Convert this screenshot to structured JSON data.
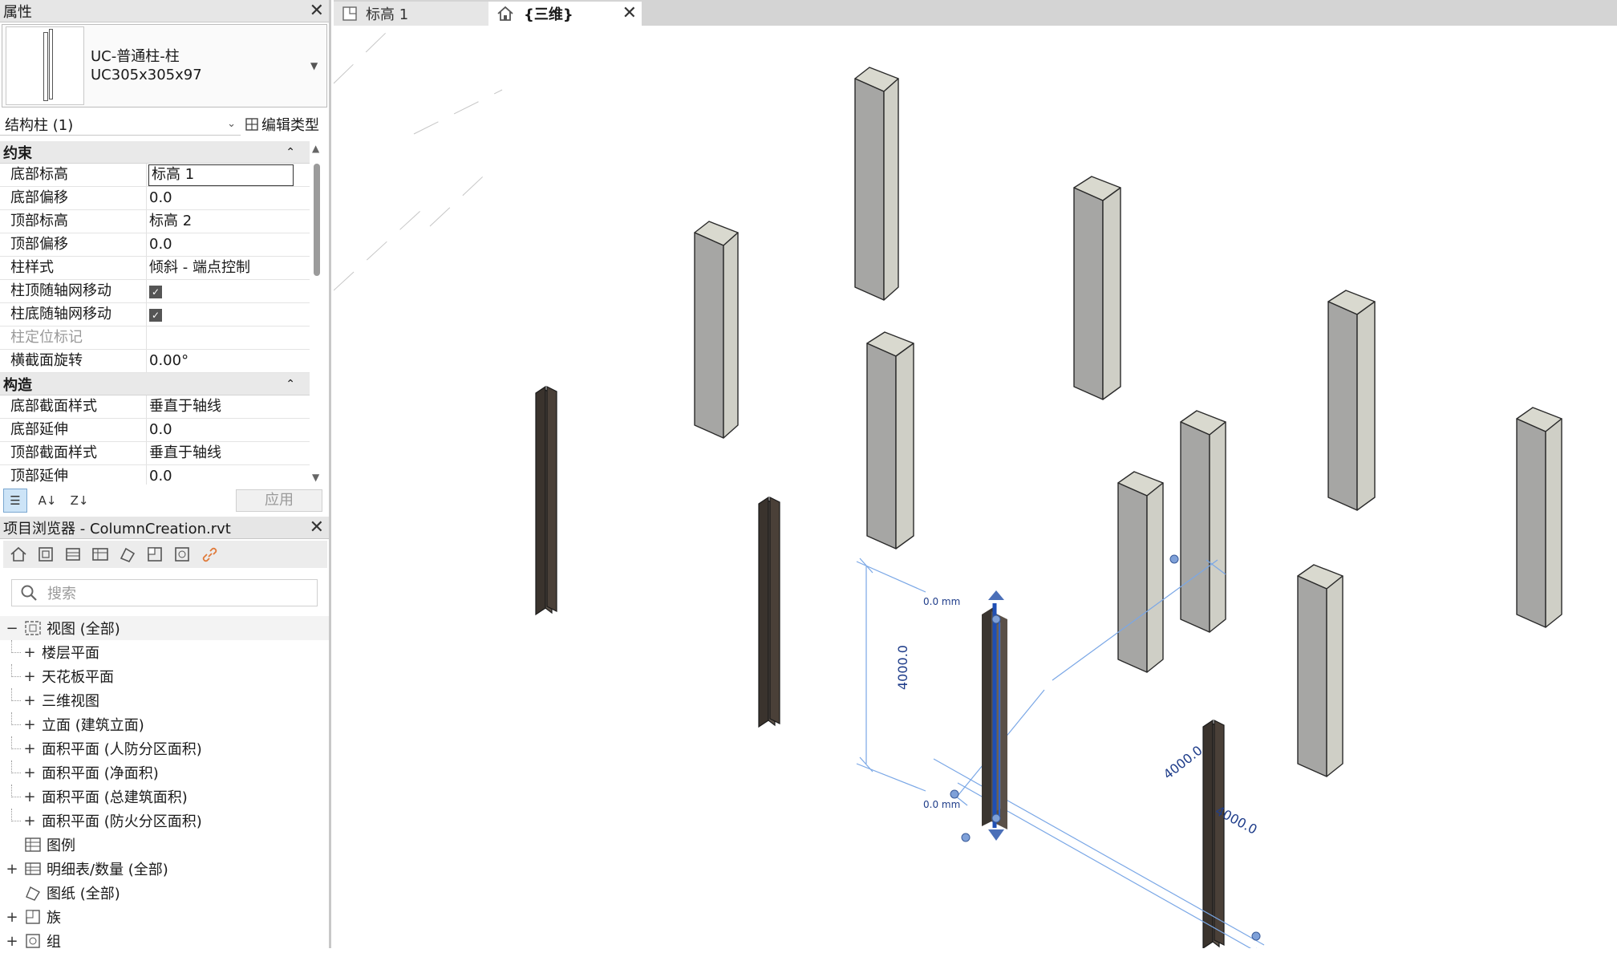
{
  "properties": {
    "title": "属性",
    "type_name_line1": "UC-普通柱-柱",
    "type_name_line2": "UC305x305x97",
    "filter_label": "结构柱 (1)",
    "edit_type_label": "编辑类型",
    "apply_label": "应用",
    "groups": [
      {
        "name": "约束",
        "rows": [
          {
            "key": "底部标高",
            "value": "标高 1",
            "kind": "edit"
          },
          {
            "key": "底部偏移",
            "value": "0.0"
          },
          {
            "key": "顶部标高",
            "value": "标高 2"
          },
          {
            "key": "顶部偏移",
            "value": "0.0"
          },
          {
            "key": "柱样式",
            "value": "倾斜 - 端点控制"
          },
          {
            "key": "柱顶随轴网移动",
            "value": "",
            "kind": "check",
            "checked": true
          },
          {
            "key": "柱底随轴网移动",
            "value": "",
            "kind": "check",
            "checked": true
          },
          {
            "key": "柱定位标记",
            "value": "",
            "kind": "dim"
          },
          {
            "key": "横截面旋转",
            "value": "0.00°"
          }
        ]
      },
      {
        "name": "构造",
        "rows": [
          {
            "key": "底部截面样式",
            "value": "垂直于轴线"
          },
          {
            "key": "底部延伸",
            "value": "0.0"
          },
          {
            "key": "顶部截面样式",
            "value": "垂直于轴线"
          },
          {
            "key": "顶部延伸",
            "value": "0.0"
          }
        ]
      }
    ]
  },
  "project_browser": {
    "title": "项目浏览器 - ColumnCreation.rvt",
    "search_placeholder": "搜索",
    "tree": [
      {
        "label": "视图 (全部)",
        "level": 0,
        "toggle": "−",
        "icon": "views-icon",
        "selected": true
      },
      {
        "label": "楼层平面",
        "level": 1,
        "toggle": "+"
      },
      {
        "label": "天花板平面",
        "level": 1,
        "toggle": "+"
      },
      {
        "label": "三维视图",
        "level": 1,
        "toggle": "+"
      },
      {
        "label": "立面 (建筑立面)",
        "level": 1,
        "toggle": "+"
      },
      {
        "label": "面积平面 (人防分区面积)",
        "level": 1,
        "toggle": "+"
      },
      {
        "label": "面积平面 (净面积)",
        "level": 1,
        "toggle": "+"
      },
      {
        "label": "面积平面 (总建筑面积)",
        "level": 1,
        "toggle": "+"
      },
      {
        "label": "面积平面 (防火分区面积)",
        "level": 1,
        "toggle": "+"
      },
      {
        "label": "图例",
        "level": 0,
        "toggle": "",
        "icon": "legend-icon"
      },
      {
        "label": "明细表/数量 (全部)",
        "level": 0,
        "toggle": "+",
        "icon": "schedule-icon"
      },
      {
        "label": "图纸 (全部)",
        "level": 0,
        "toggle": "",
        "icon": "sheet-icon"
      },
      {
        "label": "族",
        "level": 0,
        "toggle": "+",
        "icon": "family-icon"
      },
      {
        "label": "组",
        "level": 0,
        "toggle": "+",
        "icon": "group-icon"
      }
    ]
  },
  "tabs": [
    {
      "label": "标高 1",
      "active": false,
      "icon": "plan-view-icon"
    },
    {
      "label": "{三维}",
      "active": true,
      "icon": "home-3d-icon"
    }
  ],
  "view": {
    "dim_height": "4000.0",
    "dim_diag_a": "4000.0",
    "dim_diag_b": "4000.0",
    "temp_label_top": "0.0 mm",
    "temp_label_bottom": "0.0 mm"
  },
  "colors": {
    "concrete_top": "#d9d9cf",
    "concrete_left": "#a6a6a4",
    "concrete_right": "#cfcfc6",
    "steel_dark": "#4a4038",
    "selection_blue": "#1f4fb4",
    "dimension_blue": "#7aa7e6"
  }
}
